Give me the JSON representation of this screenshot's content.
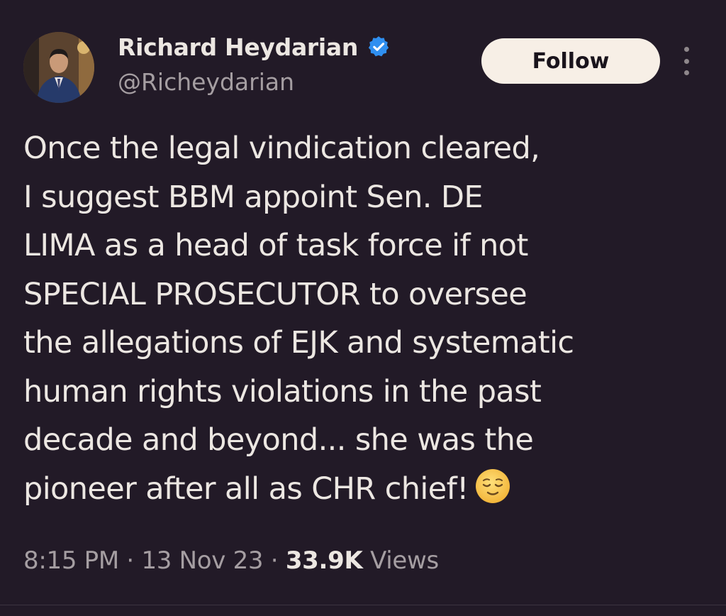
{
  "author": {
    "display_name": "Richard Heydarian",
    "handle": "@Richeydarian",
    "verified": true,
    "verified_color": "#2f8ff0"
  },
  "actions": {
    "follow_label": "Follow",
    "more_icon": "more-vertical-icon"
  },
  "tweet": {
    "lines": [
      "Once the legal vindication cleared,",
      "I suggest BBM appoint Sen. DE",
      "LIMA as a head of task force if not",
      "SPECIAL PROSECUTOR to oversee",
      "the allegations of EJK and systematic",
      "human rights violations in the past",
      "decade and beyond... she was the",
      "pioneer after all as CHR chief!"
    ],
    "emoji": "relieved-face-emoji"
  },
  "meta": {
    "time": "8:15 PM",
    "separator": "·",
    "date": "13 Nov 23",
    "views_count": "33.9K",
    "views_label": "Views"
  },
  "colors": {
    "background": "#221a27",
    "text": "#ece7e2",
    "muted": "#a59ea2",
    "button_bg": "#f7efe6"
  }
}
